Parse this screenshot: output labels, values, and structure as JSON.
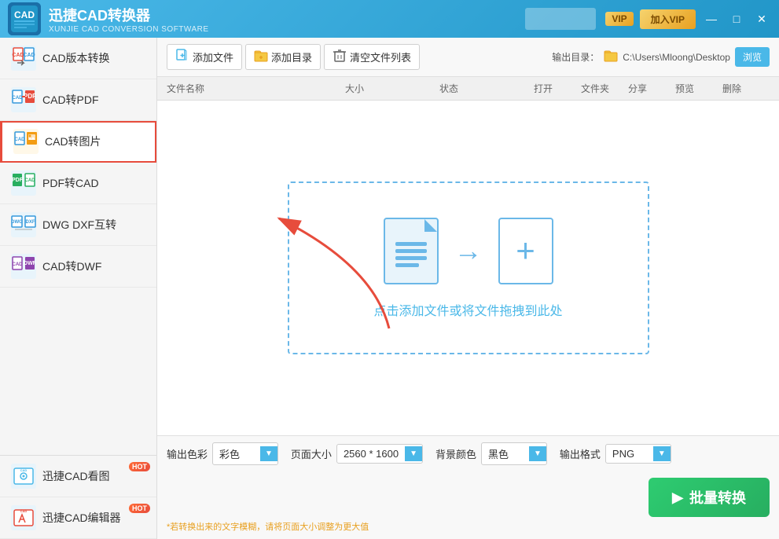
{
  "app": {
    "logo": "CAD",
    "title": "迅捷CAD转换器",
    "subtitle": "XUNJIE CAD CONVERSION SOFTWARE"
  },
  "titlebar": {
    "user_placeholder": "",
    "vip_label": "VIP",
    "join_vip_label": "加入VIP",
    "minimize": "—",
    "restore": "□",
    "close": "✕"
  },
  "sidebar": {
    "items": [
      {
        "id": "cad-version",
        "label": "CAD版本转换",
        "active": false
      },
      {
        "id": "cad-pdf",
        "label": "CAD转PDF",
        "active": false
      },
      {
        "id": "cad-img",
        "label": "CAD转图片",
        "active": true
      },
      {
        "id": "pdf-cad",
        "label": "PDF转CAD",
        "active": false
      },
      {
        "id": "dwg-dxf",
        "label": "DWG DXF互转",
        "active": false
      },
      {
        "id": "cad-dwf",
        "label": "CAD转DWF",
        "active": false
      }
    ],
    "bottom_items": [
      {
        "id": "cad-viewer",
        "label": "迅捷CAD看图",
        "hot": true
      },
      {
        "id": "cad-editor",
        "label": "迅捷CAD编辑器",
        "hot": true
      }
    ]
  },
  "toolbar": {
    "add_file": "添加文件",
    "add_dir": "添加目录",
    "clear_list": "清空文件列表",
    "output_dir_label": "输出目录：",
    "output_dir_path": "C:\\Users\\Mloong\\Desktop",
    "browse_label": "浏览"
  },
  "file_list": {
    "columns": [
      "文件名称",
      "大小",
      "状态",
      "打开",
      "文件夹",
      "分享",
      "预览",
      "删除"
    ]
  },
  "drop_zone": {
    "text": "点击添加文件或将文件拖拽到此处"
  },
  "bottom": {
    "color_label": "输出色彩",
    "color_value": "彩色",
    "page_size_label": "页面大小",
    "page_size_value": "2560 * 1600",
    "bg_color_label": "背景颜色",
    "bg_color_value": "黑色",
    "format_label": "输出格式",
    "format_value": "PNG",
    "note": "*若转换出来的文字模糊，请将页面大小调整为更大值",
    "convert_btn": "批量转换"
  }
}
